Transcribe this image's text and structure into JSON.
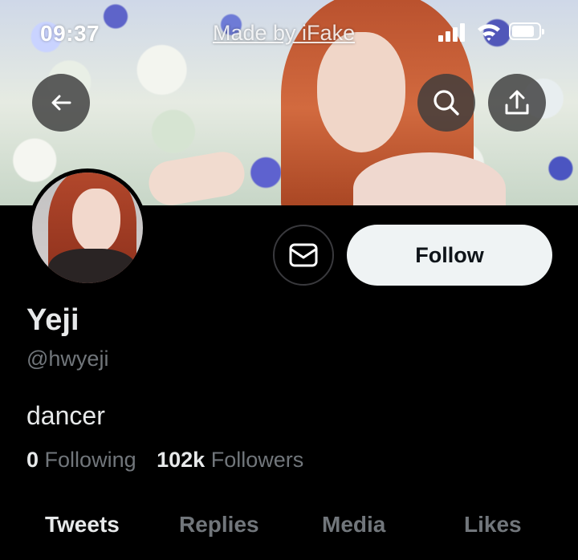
{
  "status_bar": {
    "time": "09:37",
    "watermark": "Made by iFake",
    "battery_level": 0.85
  },
  "header": {
    "back_icon": "arrow-left-icon",
    "search_icon": "search-icon",
    "share_icon": "share-upload-icon"
  },
  "profile": {
    "name": "Yeji",
    "handle": "@hwyeji",
    "bio": "dancer",
    "following_count": "0",
    "following_label": "Following",
    "followers_count": "102k",
    "followers_label": "Followers"
  },
  "actions": {
    "message_icon": "envelope-icon",
    "follow_label": "Follow"
  },
  "tabs": [
    {
      "label": "Tweets",
      "active": true
    },
    {
      "label": "Replies",
      "active": false
    },
    {
      "label": "Media",
      "active": false
    },
    {
      "label": "Likes",
      "active": false
    }
  ],
  "colors": {
    "background": "#000000",
    "primary_text": "#e7e9ea",
    "secondary_text": "#71767b",
    "follow_button_bg": "#eff3f4"
  }
}
